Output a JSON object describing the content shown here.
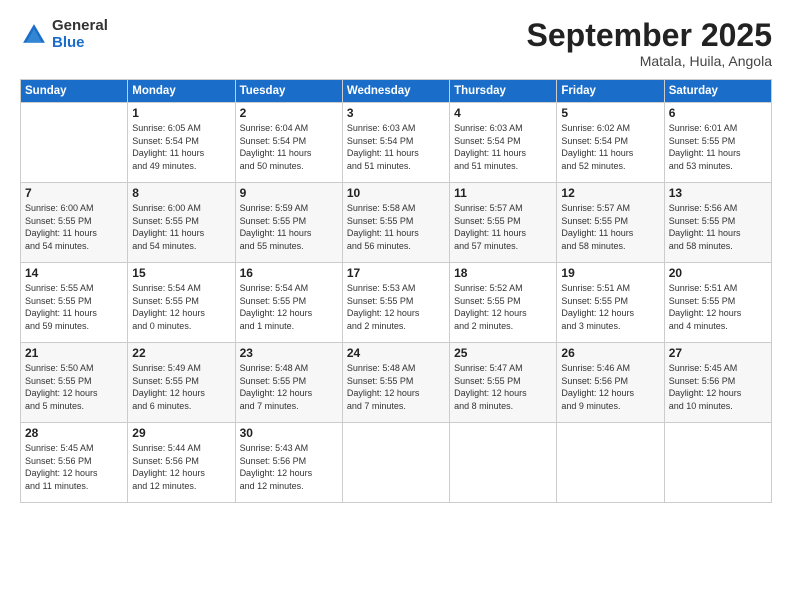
{
  "logo": {
    "general": "General",
    "blue": "Blue"
  },
  "header": {
    "month": "September 2025",
    "location": "Matala, Huila, Angola"
  },
  "days_of_week": [
    "Sunday",
    "Monday",
    "Tuesday",
    "Wednesday",
    "Thursday",
    "Friday",
    "Saturday"
  ],
  "weeks": [
    [
      {
        "day": "",
        "info": ""
      },
      {
        "day": "1",
        "info": "Sunrise: 6:05 AM\nSunset: 5:54 PM\nDaylight: 11 hours\nand 49 minutes."
      },
      {
        "day": "2",
        "info": "Sunrise: 6:04 AM\nSunset: 5:54 PM\nDaylight: 11 hours\nand 50 minutes."
      },
      {
        "day": "3",
        "info": "Sunrise: 6:03 AM\nSunset: 5:54 PM\nDaylight: 11 hours\nand 51 minutes."
      },
      {
        "day": "4",
        "info": "Sunrise: 6:03 AM\nSunset: 5:54 PM\nDaylight: 11 hours\nand 51 minutes."
      },
      {
        "day": "5",
        "info": "Sunrise: 6:02 AM\nSunset: 5:54 PM\nDaylight: 11 hours\nand 52 minutes."
      },
      {
        "day": "6",
        "info": "Sunrise: 6:01 AM\nSunset: 5:55 PM\nDaylight: 11 hours\nand 53 minutes."
      }
    ],
    [
      {
        "day": "7",
        "info": "Sunrise: 6:00 AM\nSunset: 5:55 PM\nDaylight: 11 hours\nand 54 minutes."
      },
      {
        "day": "8",
        "info": "Sunrise: 6:00 AM\nSunset: 5:55 PM\nDaylight: 11 hours\nand 54 minutes."
      },
      {
        "day": "9",
        "info": "Sunrise: 5:59 AM\nSunset: 5:55 PM\nDaylight: 11 hours\nand 55 minutes."
      },
      {
        "day": "10",
        "info": "Sunrise: 5:58 AM\nSunset: 5:55 PM\nDaylight: 11 hours\nand 56 minutes."
      },
      {
        "day": "11",
        "info": "Sunrise: 5:57 AM\nSunset: 5:55 PM\nDaylight: 11 hours\nand 57 minutes."
      },
      {
        "day": "12",
        "info": "Sunrise: 5:57 AM\nSunset: 5:55 PM\nDaylight: 11 hours\nand 58 minutes."
      },
      {
        "day": "13",
        "info": "Sunrise: 5:56 AM\nSunset: 5:55 PM\nDaylight: 11 hours\nand 58 minutes."
      }
    ],
    [
      {
        "day": "14",
        "info": "Sunrise: 5:55 AM\nSunset: 5:55 PM\nDaylight: 11 hours\nand 59 minutes."
      },
      {
        "day": "15",
        "info": "Sunrise: 5:54 AM\nSunset: 5:55 PM\nDaylight: 12 hours\nand 0 minutes."
      },
      {
        "day": "16",
        "info": "Sunrise: 5:54 AM\nSunset: 5:55 PM\nDaylight: 12 hours\nand 1 minute."
      },
      {
        "day": "17",
        "info": "Sunrise: 5:53 AM\nSunset: 5:55 PM\nDaylight: 12 hours\nand 2 minutes."
      },
      {
        "day": "18",
        "info": "Sunrise: 5:52 AM\nSunset: 5:55 PM\nDaylight: 12 hours\nand 2 minutes."
      },
      {
        "day": "19",
        "info": "Sunrise: 5:51 AM\nSunset: 5:55 PM\nDaylight: 12 hours\nand 3 minutes."
      },
      {
        "day": "20",
        "info": "Sunrise: 5:51 AM\nSunset: 5:55 PM\nDaylight: 12 hours\nand 4 minutes."
      }
    ],
    [
      {
        "day": "21",
        "info": "Sunrise: 5:50 AM\nSunset: 5:55 PM\nDaylight: 12 hours\nand 5 minutes."
      },
      {
        "day": "22",
        "info": "Sunrise: 5:49 AM\nSunset: 5:55 PM\nDaylight: 12 hours\nand 6 minutes."
      },
      {
        "day": "23",
        "info": "Sunrise: 5:48 AM\nSunset: 5:55 PM\nDaylight: 12 hours\nand 7 minutes."
      },
      {
        "day": "24",
        "info": "Sunrise: 5:48 AM\nSunset: 5:55 PM\nDaylight: 12 hours\nand 7 minutes."
      },
      {
        "day": "25",
        "info": "Sunrise: 5:47 AM\nSunset: 5:55 PM\nDaylight: 12 hours\nand 8 minutes."
      },
      {
        "day": "26",
        "info": "Sunrise: 5:46 AM\nSunset: 5:56 PM\nDaylight: 12 hours\nand 9 minutes."
      },
      {
        "day": "27",
        "info": "Sunrise: 5:45 AM\nSunset: 5:56 PM\nDaylight: 12 hours\nand 10 minutes."
      }
    ],
    [
      {
        "day": "28",
        "info": "Sunrise: 5:45 AM\nSunset: 5:56 PM\nDaylight: 12 hours\nand 11 minutes."
      },
      {
        "day": "29",
        "info": "Sunrise: 5:44 AM\nSunset: 5:56 PM\nDaylight: 12 hours\nand 12 minutes."
      },
      {
        "day": "30",
        "info": "Sunrise: 5:43 AM\nSunset: 5:56 PM\nDaylight: 12 hours\nand 12 minutes."
      },
      {
        "day": "",
        "info": ""
      },
      {
        "day": "",
        "info": ""
      },
      {
        "day": "",
        "info": ""
      },
      {
        "day": "",
        "info": ""
      }
    ]
  ]
}
